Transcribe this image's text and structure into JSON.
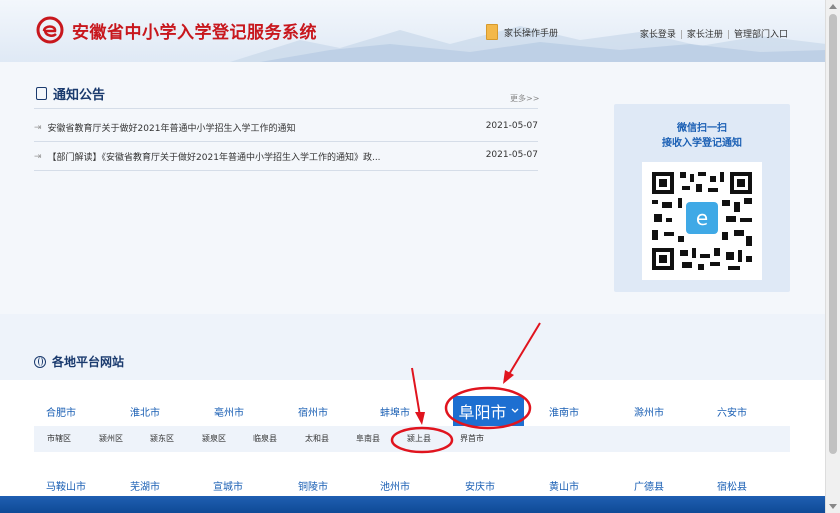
{
  "header": {
    "title": "安徽省中小学入学登记服务系统",
    "manual_label": "家长操作手册",
    "links": [
      "家长登录",
      "家长注册",
      "管理部门入口"
    ]
  },
  "notice": {
    "title": "通知公告",
    "more": "更多>>",
    "items": [
      {
        "text": "安徽省教育厅关于做好2021年普通中小学招生入学工作的通知",
        "date": "2021-05-07"
      },
      {
        "text": "【部门解读】《安徽省教育厅关于做好2021年普通中小学招生入学工作的通知》政...",
        "date": "2021-05-07"
      }
    ]
  },
  "qr": {
    "line1": "微信扫一扫",
    "line2": "接收入学登记通知"
  },
  "region": {
    "title": "各地平台网站",
    "cities_row1": [
      "合肥市",
      "淮北市",
      "亳州市",
      "宿州市",
      "蚌埠市",
      "阜阳市",
      "淮南市",
      "滁州市",
      "六安市"
    ],
    "active_city": "阜阳市",
    "counties": [
      "市辖区",
      "颍州区",
      "颍东区",
      "颍泉区",
      "临泉县",
      "太和县",
      "阜南县",
      "颍上县",
      "界首市"
    ],
    "cities_row2": [
      "马鞍山市",
      "芜湖市",
      "宣城市",
      "铜陵市",
      "池州市",
      "安庆市",
      "黄山市",
      "广德县",
      "宿松县"
    ]
  },
  "colors": {
    "brand_red": "#c8171d",
    "link_blue": "#1a5fb4",
    "active_blue": "#1d6fd1",
    "annotation_red": "#e0141e"
  },
  "icons": [
    "logo-icon",
    "book-icon",
    "notice-icon",
    "arrow-bullet-icon",
    "globe-icon",
    "chevron-down-icon",
    "qr-code-icon"
  ]
}
